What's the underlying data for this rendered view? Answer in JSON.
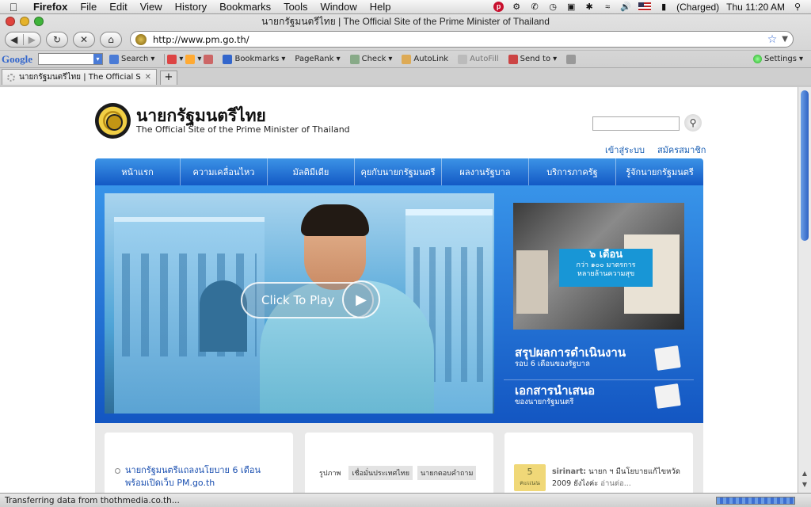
{
  "menubar": {
    "apple": "",
    "items": [
      "Firefox",
      "File",
      "Edit",
      "View",
      "History",
      "Bookmarks",
      "Tools",
      "Window",
      "Help"
    ],
    "battery": "(Charged)",
    "clock": "Thu 11:20 AM"
  },
  "window": {
    "title": "นายกรัฐมนตรีไทย | The Official Site of the Prime Minister of Thailand",
    "url": "http://www.pm.go.th/"
  },
  "toolbar": {
    "google_logo": "Google",
    "search": "Search",
    "bookmarks": "Bookmarks",
    "pagerank": "PageRank",
    "check": "Check",
    "autolink": "AutoLink",
    "autofill": "AutoFill",
    "sendto": "Send to",
    "settings": "Settings"
  },
  "tab": {
    "title": "นายกรัฐมนตรีไทย | The Official Site o...",
    "new_tab": "+"
  },
  "status": {
    "text": "Transferring data from thothmedia.co.th..."
  },
  "site": {
    "title_th": "นายกรัฐมนตรีไทย",
    "title_en": "The Official Site of the Prime Minister of Thailand",
    "login": "เข้าสู่ระบบ",
    "register": "สมัครสมาชิก",
    "nav": [
      {
        "label": "หน้าแรก",
        "w": 108
      },
      {
        "label": "ความเคลื่อนไหว",
        "w": 110
      },
      {
        "label": "มัลติมีเดีย",
        "w": 110
      },
      {
        "label": "คุยกับนายกรัฐมนตรี",
        "w": 110
      },
      {
        "label": "ผลงานรัฐบาล",
        "w": 110
      },
      {
        "label": "บริการภาครัฐ",
        "w": 110
      },
      {
        "label": "รู้จักนายกรัฐมนตรี",
        "w": 110
      }
    ],
    "play_label": "Click To Play",
    "banner_line1": "๖ เดือน",
    "banner_line2": "กว่า ๑๐๐ มาตรการ",
    "banner_line3": "หลายล้านความสุข",
    "promo1_title": "สรุปผลการดำเนินงาน",
    "promo1_sub": "รอบ 6 เดือนของรัฐบาล",
    "promo2_title": "เอกสารนำเสนอ",
    "promo2_sub": "ของนายกรัฐมนตรี",
    "news_item": "นายกรัฐมนตรีแถลงนโยบาย 6 เดือน พร้อมเปิดเว็บ PM.go.th",
    "media_tabs": [
      "รูปภาพ",
      "เชื่อมั่นประเทศไทย",
      "นายกตอบคำถาม"
    ],
    "score_value": "5",
    "score_unit": "คะแนน",
    "comment_user": "sirinart:",
    "comment_text": " นายก ฯ มีนโยบายแก้ไขหวัด 2009 ยังไงค่ะ ",
    "comment_more": "อ่านต่อ..."
  }
}
